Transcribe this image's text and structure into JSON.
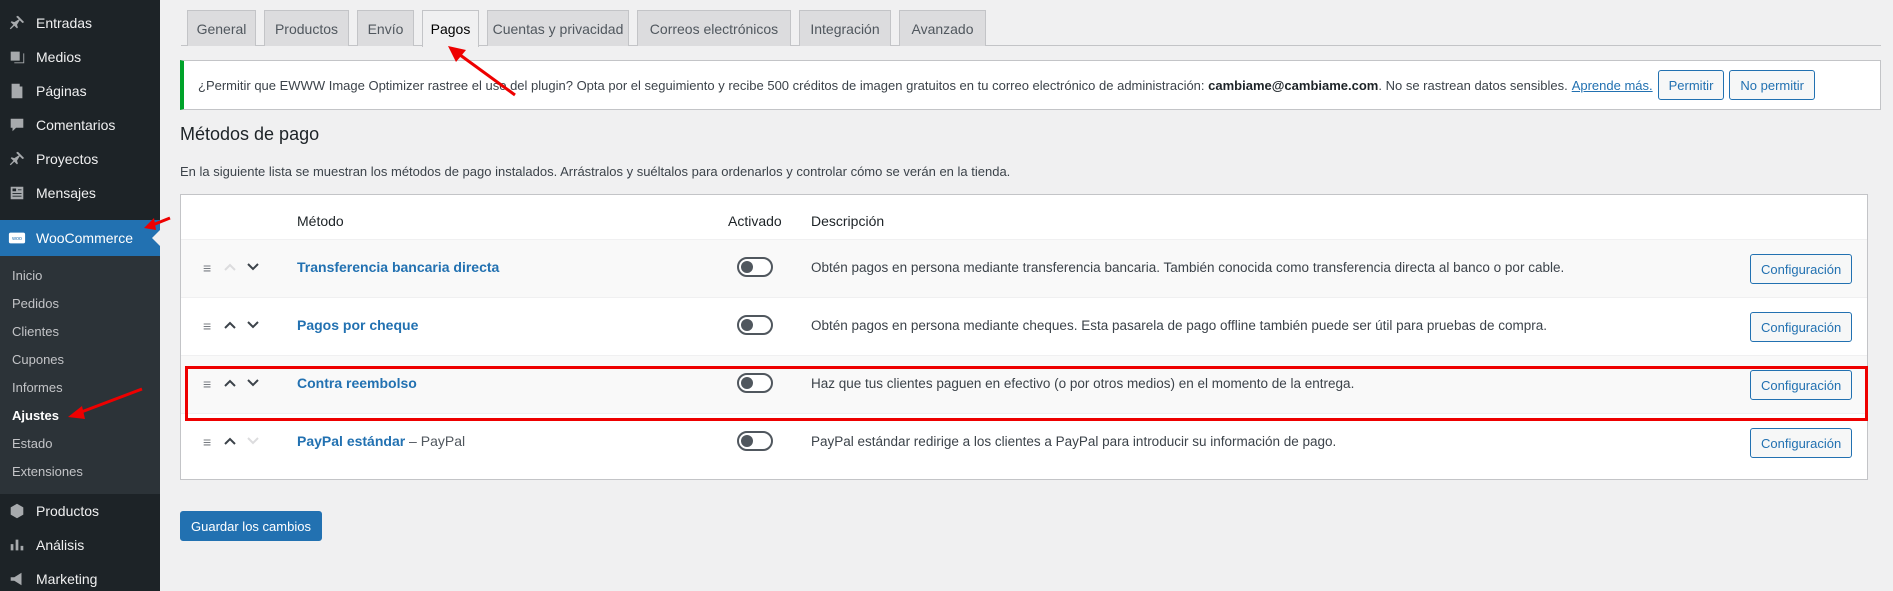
{
  "sidebar": {
    "items": [
      {
        "label": "Entradas",
        "icon": "pin-icon"
      },
      {
        "label": "Medios",
        "icon": "media-icon"
      },
      {
        "label": "Páginas",
        "icon": "pages-icon"
      },
      {
        "label": "Comentarios",
        "icon": "comment-icon"
      },
      {
        "label": "Proyectos",
        "icon": "pin-icon"
      },
      {
        "label": "Mensajes",
        "icon": "messages-icon"
      }
    ],
    "woocommerce": {
      "label": "WooCommerce",
      "icon": "woo-icon"
    },
    "submenu": [
      "Inicio",
      "Pedidos",
      "Clientes",
      "Cupones",
      "Informes",
      "Ajustes",
      "Estado",
      "Extensiones"
    ],
    "submenu_current": "Ajustes",
    "bottom_items": [
      {
        "label": "Productos",
        "icon": "box-icon"
      },
      {
        "label": "Análisis",
        "icon": "chart-icon"
      },
      {
        "label": "Marketing",
        "icon": "megaphone-icon"
      }
    ]
  },
  "tabs": [
    "General",
    "Productos",
    "Envío",
    "Pagos",
    "Cuentas y privacidad",
    "Correos electrónicos",
    "Integración",
    "Avanzado"
  ],
  "active_tab": "Pagos",
  "notice": {
    "text": "¿Permitir que EWWW Image Optimizer rastree el uso del plugin? Opta por el seguimiento y recibe 500 créditos de imagen gratuitos en tu correo electrónico de administración:",
    "email": "cambiame@cambiame.com",
    "tail": ". No se rastrean datos sensibles.",
    "learn_more": "Aprende más.",
    "allow": "Permitir",
    "deny": "No permitir"
  },
  "section": {
    "title": "Métodos de pago",
    "description": "En la siguiente lista se muestran los métodos de pago instalados. Arrástralos y suéltalos para ordenarlos y controlar cómo se verán en la tienda."
  },
  "table": {
    "headers": {
      "method": "Método",
      "enabled": "Activado",
      "description": "Descripción"
    },
    "rows": [
      {
        "name": "Transferencia bancaria directa",
        "sub": "",
        "enabled": false,
        "description": "Obtén pagos en persona mediante transferencia bancaria. También conocida como transferencia directa al banco o por cable.",
        "button": "Configuración"
      },
      {
        "name": "Pagos por cheque",
        "sub": "",
        "enabled": false,
        "description": "Obtén pagos en persona mediante cheques. Esta pasarela de pago offline también puede ser útil para pruebas de compra.",
        "button": "Configuración"
      },
      {
        "name": "Contra reembolso",
        "sub": "",
        "enabled": false,
        "description": "Haz que tus clientes paguen en efectivo (o por otros medios) en el momento de la entrega.",
        "button": "Configuración"
      },
      {
        "name": "PayPal estándar",
        "sub": " – PayPal",
        "enabled": false,
        "description": "PayPal estándar redirige a los clientes a PayPal para introducir su información de pago.",
        "button": "Configuración"
      }
    ]
  },
  "save_label": "Guardar los cambios",
  "colors": {
    "accent": "#2271b1",
    "sidebar": "#1d2327",
    "highlight": "#ee0000",
    "notice_border": "#00a32a"
  }
}
